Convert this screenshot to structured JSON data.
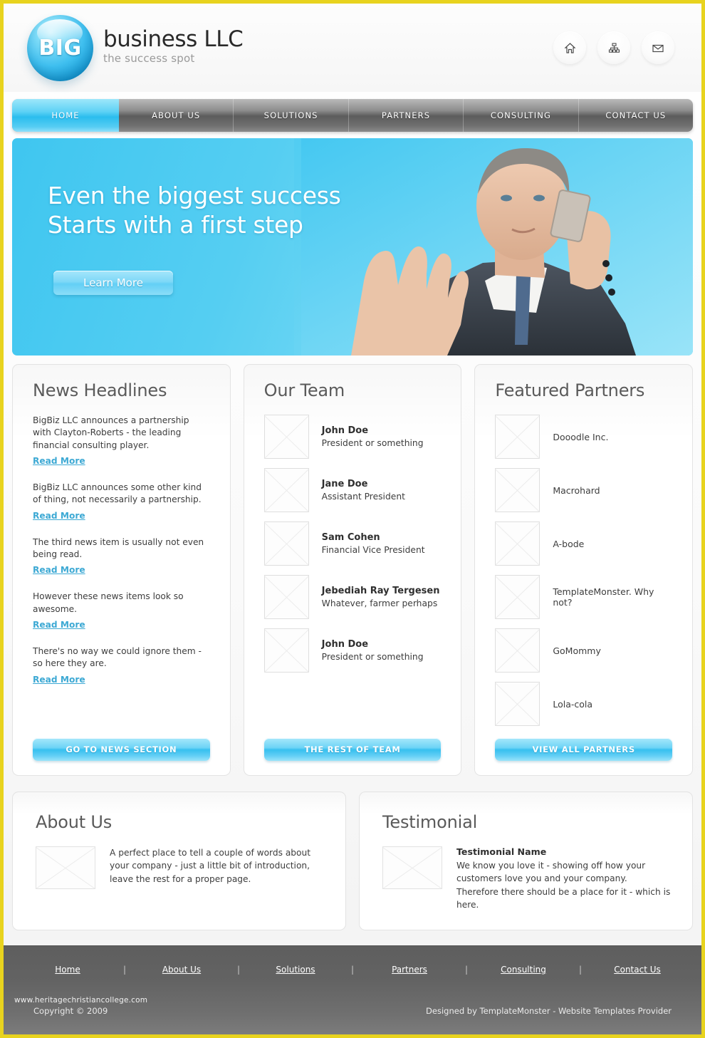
{
  "brand": {
    "orb_text": "BIG",
    "title": "business LLC",
    "tagline": "the success spot"
  },
  "header": {
    "icons": [
      {
        "name": "home-icon",
        "label": "Home"
      },
      {
        "name": "sitemap-icon",
        "label": "Sitemap"
      },
      {
        "name": "mail-icon",
        "label": "Contact"
      }
    ]
  },
  "nav": {
    "items": [
      {
        "label": "HOME",
        "active": true
      },
      {
        "label": "ABOUT US",
        "active": false
      },
      {
        "label": "SOLUTIONS",
        "active": false
      },
      {
        "label": "PARTNERS",
        "active": false
      },
      {
        "label": "CONSULTING",
        "active": false
      },
      {
        "label": "CONTACT US",
        "active": false
      }
    ]
  },
  "hero": {
    "line1": "Even the biggest success",
    "line2": "Starts with a first step",
    "button": "Learn More"
  },
  "news": {
    "title": "News Headlines",
    "items": [
      {
        "text": "BigBiz LLC announces a partnership with Clayton-Roberts - the leading financial consulting player.",
        "link": "Read More"
      },
      {
        "text": "BigBiz LLC announces some other kind of thing, not necessarily a partnership.",
        "link": "Read More"
      },
      {
        "text": "The third news item is usually not even being read.",
        "link": "Read More"
      },
      {
        "text": "However these news items look so awesome.",
        "link": "Read More"
      },
      {
        "text": "There's no way  we could ignore them - so here they are.",
        "link": "Read More"
      }
    ],
    "cta": "GO TO NEWS SECTION"
  },
  "team": {
    "title": "Our Team",
    "members": [
      {
        "name": "John Doe",
        "role": "President or something"
      },
      {
        "name": "Jane Doe",
        "role": "Assistant President"
      },
      {
        "name": "Sam Cohen",
        "role": "Financial Vice President"
      },
      {
        "name": "Jebediah Ray Tergesen",
        "role": "Whatever, farmer perhaps"
      },
      {
        "name": "John Doe",
        "role": "President or something"
      }
    ],
    "cta": "THE REST OF TEAM"
  },
  "partners": {
    "title": "Featured Partners",
    "items": [
      {
        "name": "Dooodle Inc."
      },
      {
        "name": "Macrohard"
      },
      {
        "name": "A-bode"
      },
      {
        "name": "TemplateMonster. Why not?"
      },
      {
        "name": "GoMommy"
      },
      {
        "name": "Lola-cola"
      }
    ],
    "cta": "VIEW ALL PARTNERS"
  },
  "about": {
    "title": "About Us",
    "text": "A perfect place to tell a couple of words about your company - just a little bit of introduction, leave the rest for a proper page."
  },
  "testimonial": {
    "title": "Testimonial",
    "name": "Testimonial Name",
    "text": "We know you love it - showing off how your customers love you and your company. Therefore there should be a place for it - which is here."
  },
  "footer": {
    "links": [
      {
        "label": "Home"
      },
      {
        "label": "About Us"
      },
      {
        "label": "Solutions"
      },
      {
        "label": "Partners"
      },
      {
        "label": "Consulting"
      },
      {
        "label": "Contact Us"
      }
    ],
    "separator": "|",
    "copyright": "Copyright © 2009",
    "watermark": "www.heritagechristiancollege.com",
    "designer": "Designed by TemplateMonster - Website Templates Provider"
  },
  "colors": {
    "accent": "#2bbdee",
    "border": "#e8d31e",
    "link": "#3da9d4",
    "footer_bg": "#636363"
  }
}
